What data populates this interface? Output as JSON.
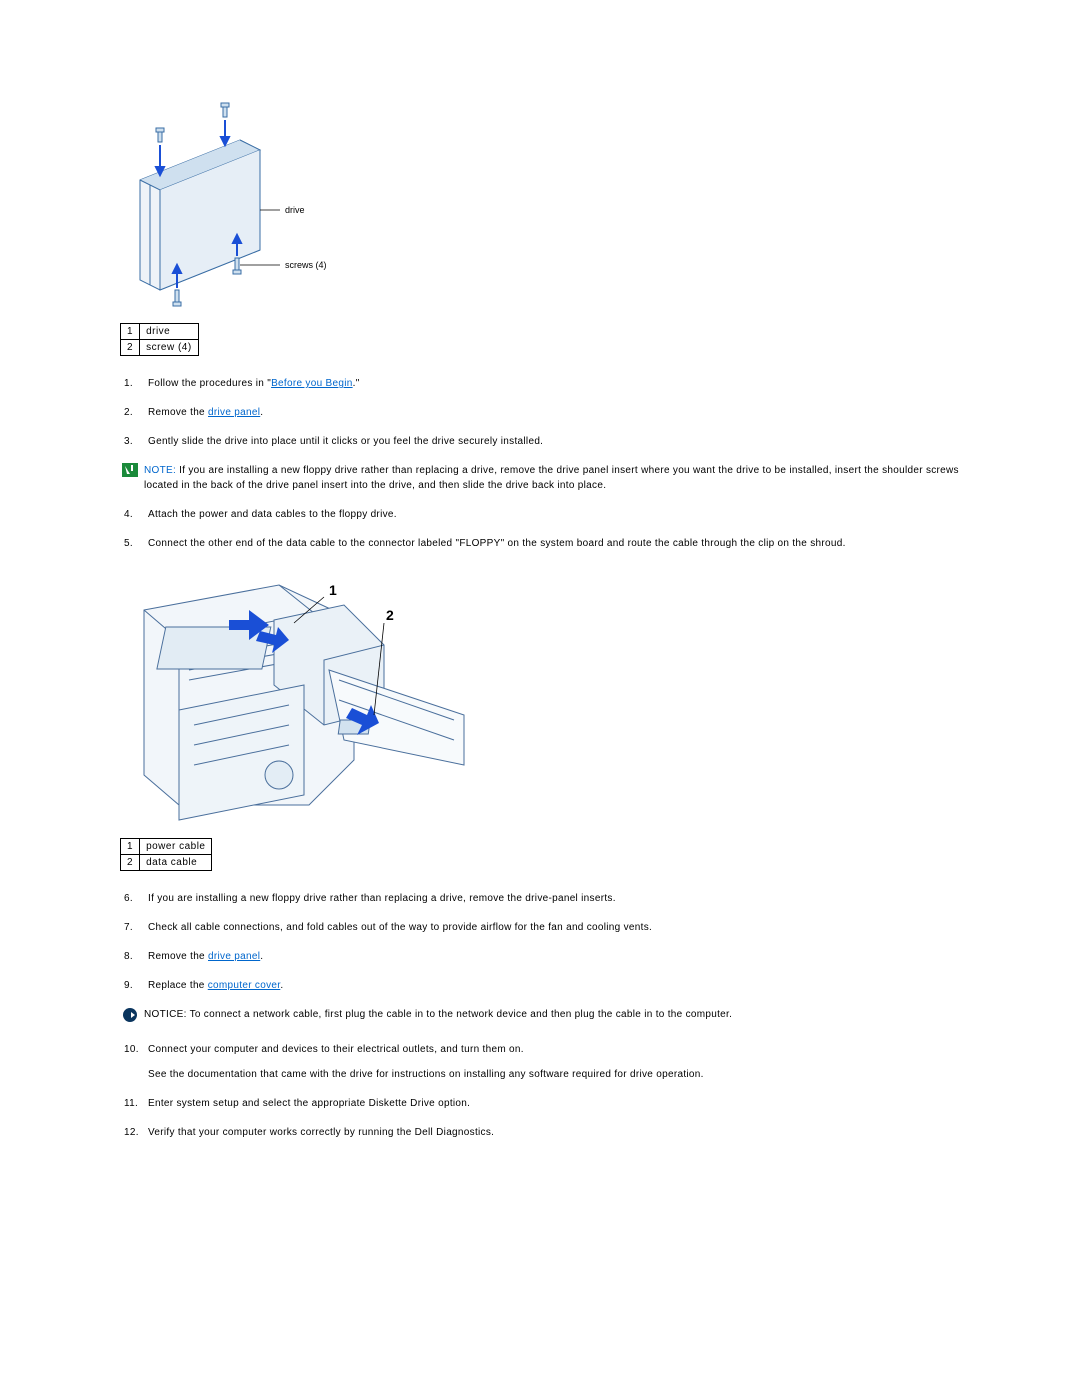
{
  "legend1": {
    "r1n": "1",
    "r1t": "drive",
    "r2n": "2",
    "r2t": "screw (4)"
  },
  "fig1": {
    "label_drive": "drive",
    "label_screws": "screws (4)"
  },
  "steps": {
    "s1n": "1.",
    "s1a": "Follow the procedures in \"",
    "s1link": "Before you Begin",
    "s1b": ".\"",
    "s2n": "2.",
    "s2a": "Remove the ",
    "s2link": "drive panel",
    "s2b": ".",
    "s3n": "3.",
    "s3t": "Gently slide the drive into place until it clicks or you feel the drive securely installed.",
    "s4n": "4.",
    "s4t": "Attach the power and data cables to the floppy drive.",
    "s5n": "5.",
    "s5t": "Connect the other end of the data cable to the connector labeled \"FLOPPY\" on the system board and route the cable through the clip on the shroud.",
    "s6n": "6.",
    "s6t": "If you are installing a new floppy drive rather than replacing a drive, remove the drive-panel inserts.",
    "s7n": "7.",
    "s7t": "Check all cable connections, and fold cables out of the way to provide airflow for the fan and cooling vents.",
    "s8n": "8.",
    "s8a": "Remove the ",
    "s8link": "drive panel",
    "s8b": ".",
    "s9n": "9.",
    "s9a": "Replace the ",
    "s9link": "computer cover",
    "s9b": ".",
    "s10n": "10.",
    "s10t": "Connect your computer and devices to their electrical outlets, and turn them on.",
    "s10sub": "See the documentation that came with the drive for instructions on installing any software required for drive operation.",
    "s11n": "11.",
    "s11t": "Enter system setup and select the appropriate Diskette Drive option.",
    "s12n": "12.",
    "s12t": "Verify that your computer works correctly by running the Dell Diagnostics."
  },
  "note": {
    "label": "NOTE:",
    "text": " If you are installing a new floppy drive rather than replacing a drive, remove the drive panel insert where you want the drive to be installed, insert the shoulder screws located in the back of the drive panel insert into the drive, and then slide the drive back into place."
  },
  "fig2": {
    "num1": "1",
    "num2": "2"
  },
  "legend2": {
    "r1n": "1",
    "r1t": "power cable",
    "r2n": "2",
    "r2t": "data cable"
  },
  "notice": {
    "label": "NOTICE:",
    "text": " To connect a network cable, first plug the cable in to the network device and then plug the cable in to the computer."
  }
}
